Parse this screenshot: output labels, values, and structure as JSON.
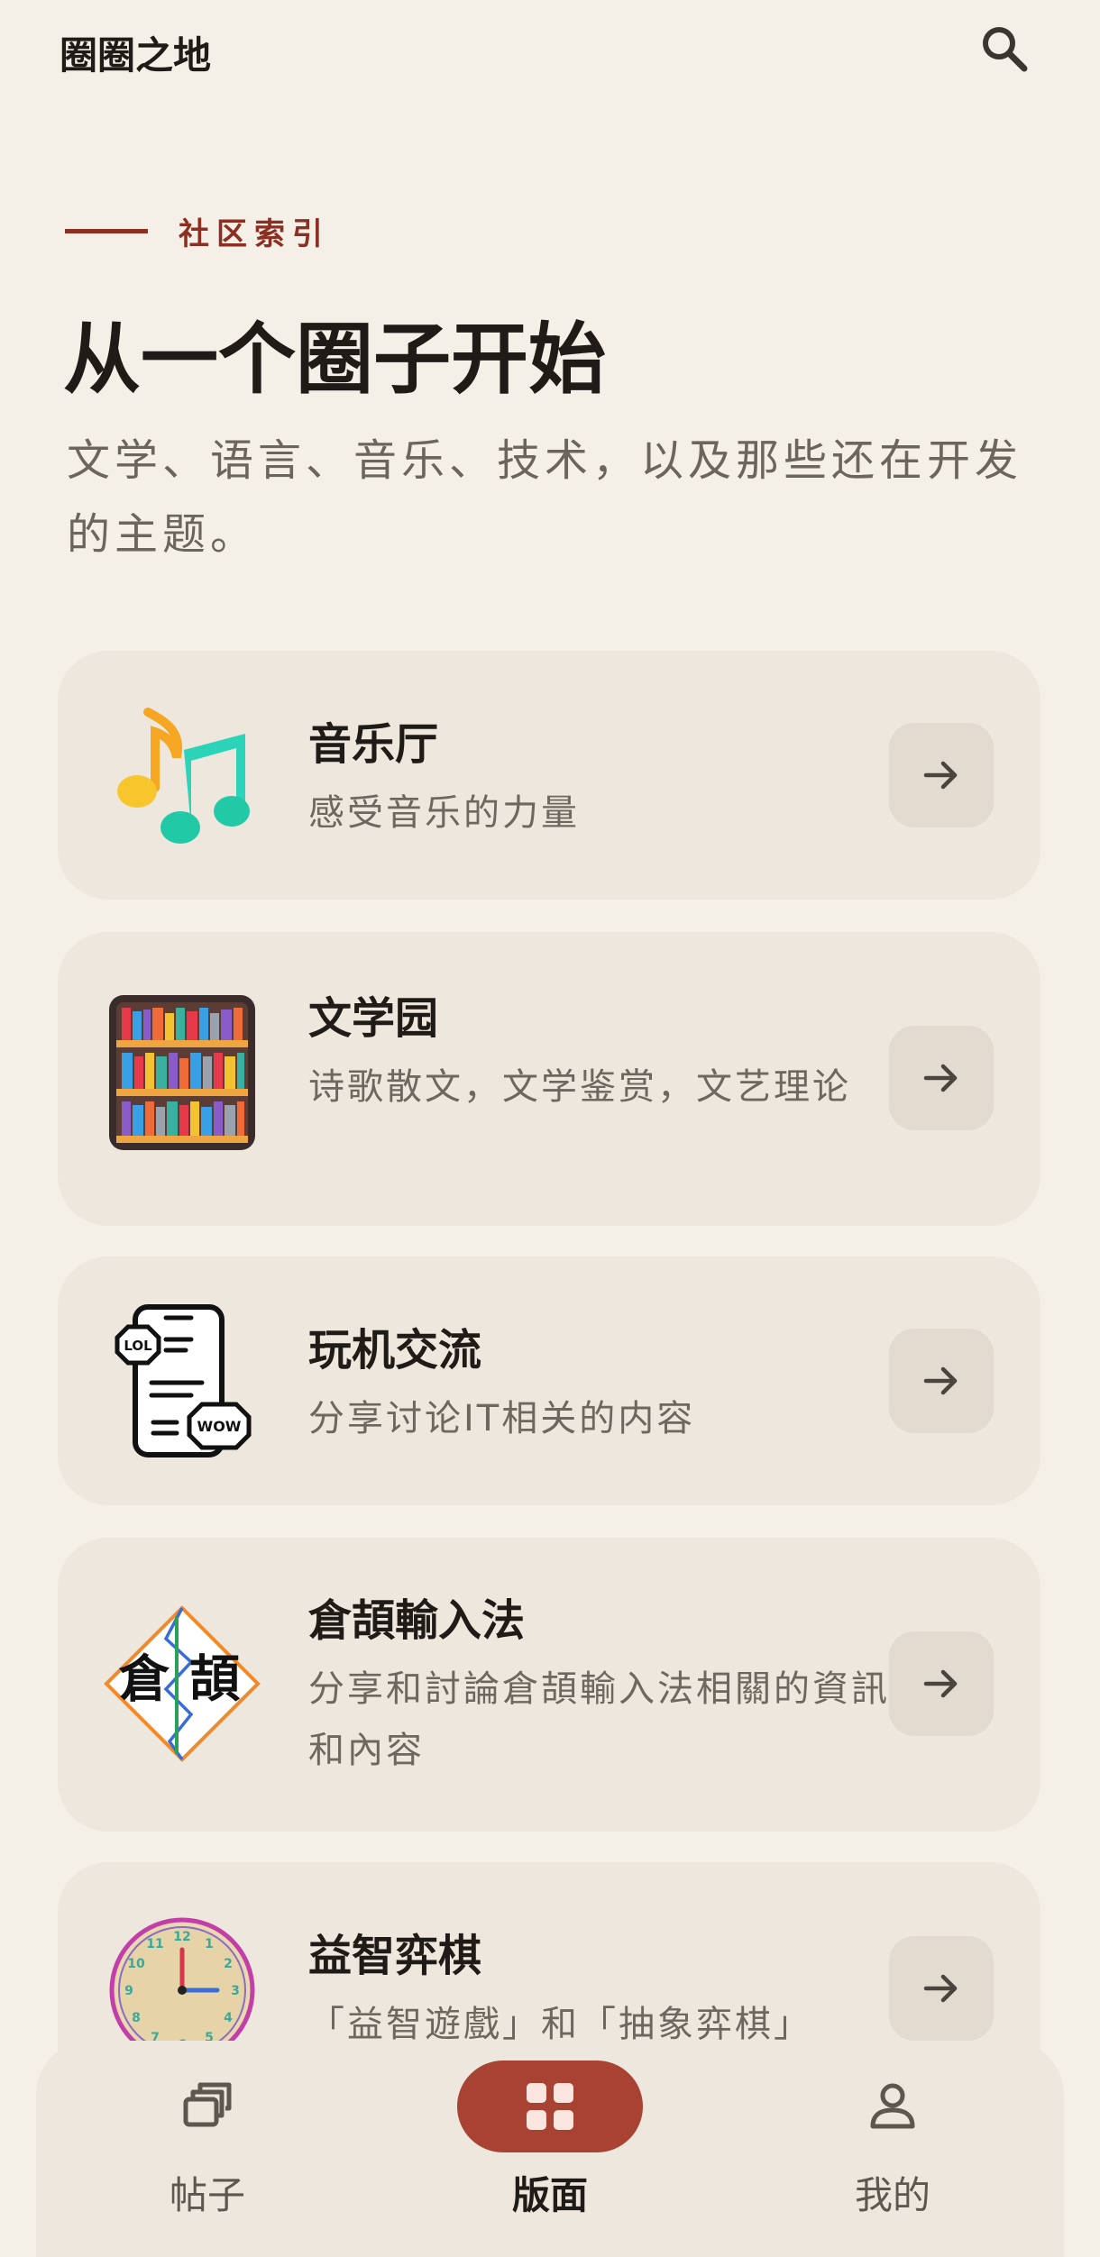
{
  "header": {
    "title": "圈圈之地",
    "search_icon": "search-icon"
  },
  "hero": {
    "eyebrow": "社区索引",
    "title": "从一个圈子开始",
    "subtitle": "文学、语言、音乐、技术，以及那些还在开发的主题。"
  },
  "boards": [
    {
      "name": "音乐厅",
      "description": "感受音乐的力量",
      "icon": "music-notes-icon"
    },
    {
      "name": "文学园",
      "description": "诗歌散文，文学鉴赏，文艺理论",
      "icon": "bookshelf-icon"
    },
    {
      "name": "玩机交流",
      "description": "分享讨论IT相关的内容",
      "icon": "phone-chat-icon"
    },
    {
      "name": "倉頡輸入法",
      "description": "分享和討論倉頡輸入法相關的資訊和內容",
      "icon": "cangjie-logo-icon"
    },
    {
      "name": "益智弈棋",
      "description": "「益智遊戲」和「抽象弈棋」",
      "icon": "clock-icon"
    }
  ],
  "nav": {
    "items": [
      {
        "label": "帖子",
        "icon": "posts-icon"
      },
      {
        "label": "版面",
        "icon": "grid-icon"
      },
      {
        "label": "我的",
        "icon": "profile-icon"
      }
    ],
    "active_index": 1
  },
  "colors": {
    "accent": "#a84232",
    "eyebrow": "#8c2f22",
    "background": "#f4f0e8",
    "card": "#ede7dd"
  }
}
